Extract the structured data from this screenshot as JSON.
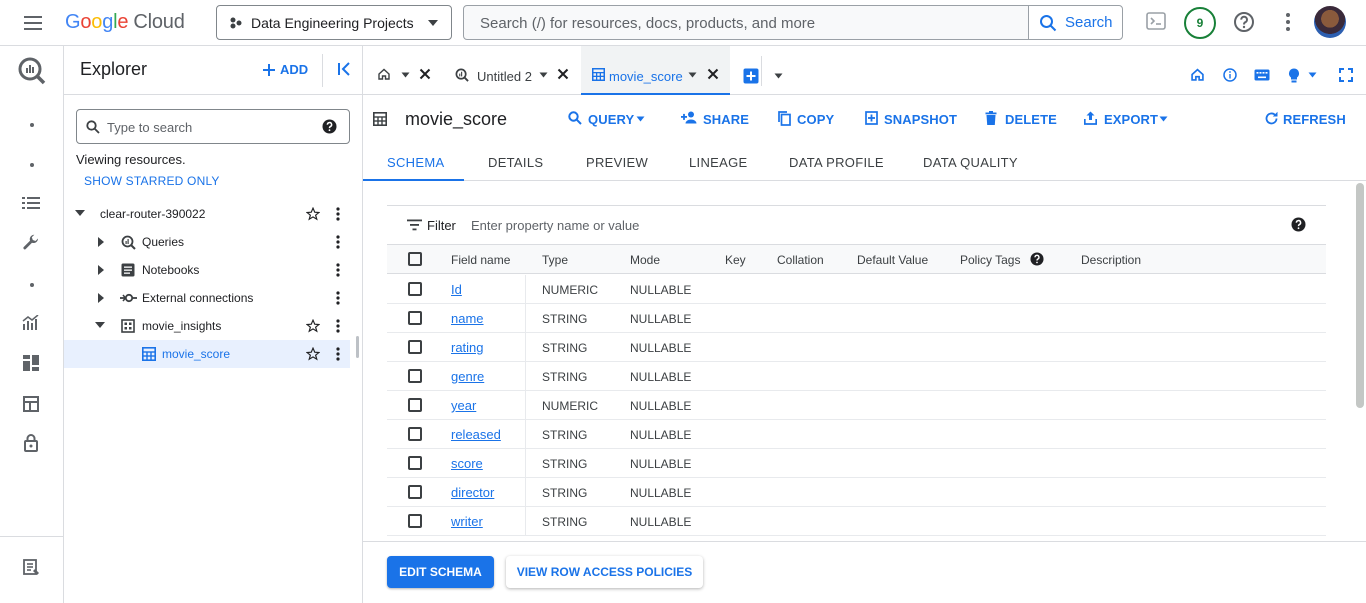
{
  "topbar": {
    "logo_google": [
      "G",
      "o",
      "o",
      "g",
      "l",
      "e"
    ],
    "logo_cloud": "Cloud",
    "project": "Data Engineering Projects",
    "search_placeholder": "Search (/) for resources, docs, products, and more",
    "search_button": "Search",
    "notification_count": "9"
  },
  "explorer": {
    "title": "Explorer",
    "add_label": "ADD",
    "search_placeholder": "Type to search",
    "viewing_text": "Viewing resources.",
    "starred_link": "SHOW STARRED ONLY",
    "tree": [
      {
        "label": "clear-router-390022",
        "icon": "caret-down-icon"
      },
      {
        "label": "Queries",
        "icon": "query-icon"
      },
      {
        "label": "Notebooks",
        "icon": "notebook-icon"
      },
      {
        "label": "External connections",
        "icon": "connection-icon"
      },
      {
        "label": "movie_insights",
        "icon": "dataset-icon"
      },
      {
        "label": "movie_score",
        "icon": "table-icon"
      }
    ]
  },
  "tabs": [
    {
      "label": "",
      "icon": "home-icon"
    },
    {
      "label": "Untitled 2",
      "icon": "query-icon"
    },
    {
      "label": "movie_score",
      "icon": "table-icon",
      "active": true
    }
  ],
  "table": {
    "title": "movie_score",
    "actions": [
      "QUERY",
      "SHARE",
      "COPY",
      "SNAPSHOT",
      "DELETE",
      "EXPORT",
      "REFRESH"
    ]
  },
  "subtabs": [
    "SCHEMA",
    "DETAILS",
    "PREVIEW",
    "LINEAGE",
    "DATA PROFILE",
    "DATA QUALITY"
  ],
  "filter": {
    "label": "Filter",
    "placeholder": "Enter property name or value"
  },
  "schema": {
    "headers": [
      "Field name",
      "Type",
      "Mode",
      "Key",
      "Collation",
      "Default Value",
      "Policy Tags",
      "Description"
    ],
    "rows": [
      {
        "name": "Id",
        "type": "NUMERIC",
        "mode": "NULLABLE"
      },
      {
        "name": "name",
        "type": "STRING",
        "mode": "NULLABLE"
      },
      {
        "name": "rating",
        "type": "STRING",
        "mode": "NULLABLE"
      },
      {
        "name": "genre",
        "type": "STRING",
        "mode": "NULLABLE"
      },
      {
        "name": "year",
        "type": "NUMERIC",
        "mode": "NULLABLE"
      },
      {
        "name": "released",
        "type": "STRING",
        "mode": "NULLABLE"
      },
      {
        "name": "score",
        "type": "STRING",
        "mode": "NULLABLE"
      },
      {
        "name": "director",
        "type": "STRING",
        "mode": "NULLABLE"
      },
      {
        "name": "writer",
        "type": "STRING",
        "mode": "NULLABLE"
      }
    ]
  },
  "buttons": {
    "edit_schema": "EDIT SCHEMA",
    "row_access": "VIEW ROW ACCESS POLICIES"
  },
  "colors": {
    "accent": "#1a73e8",
    "badge": "#188038"
  }
}
